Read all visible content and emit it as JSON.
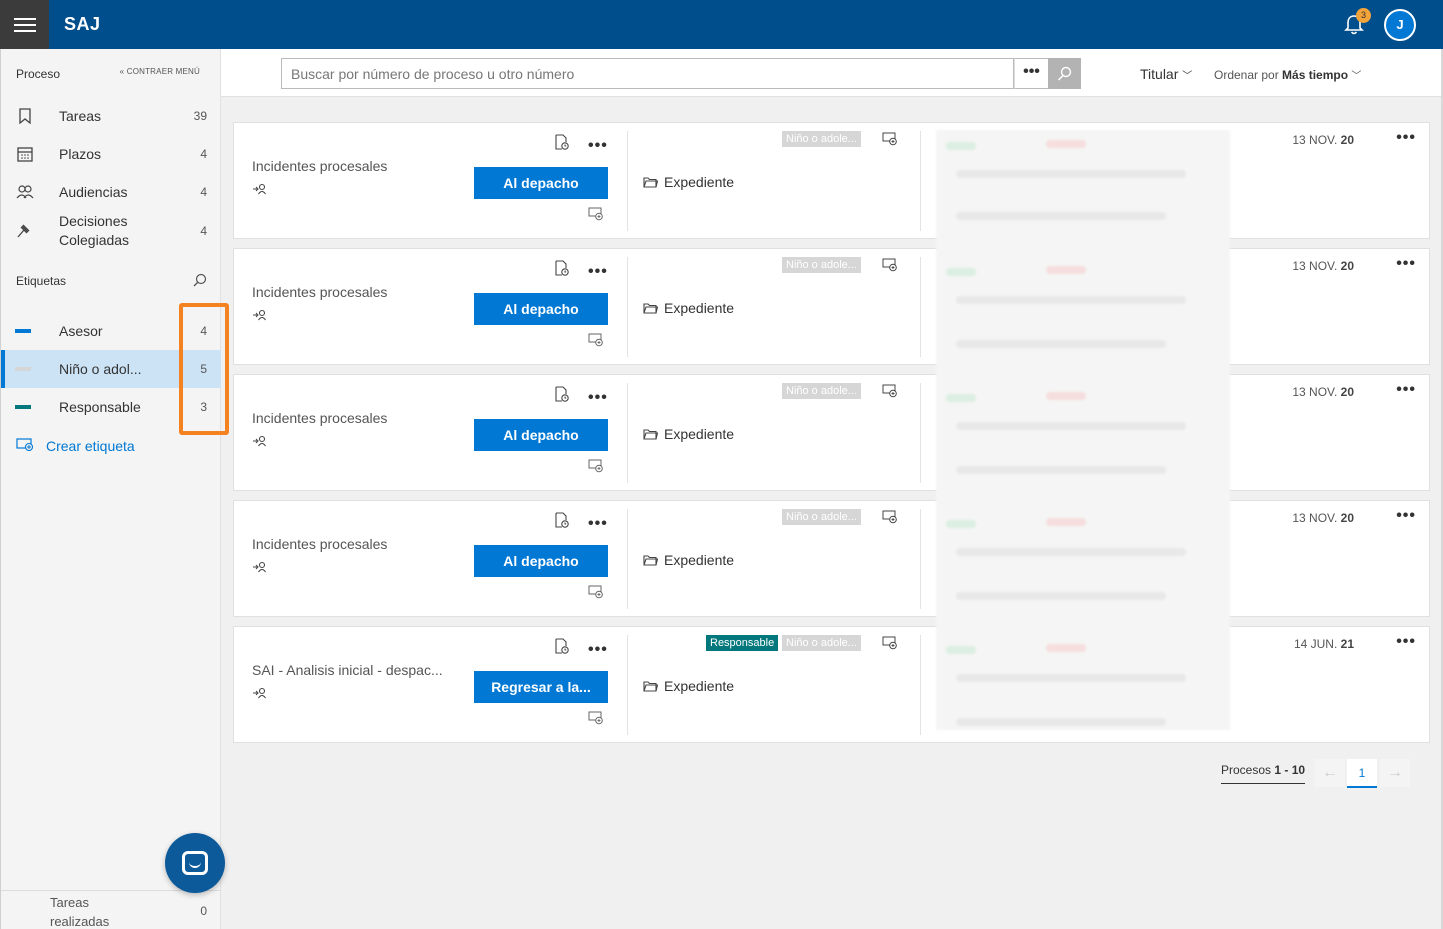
{
  "header": {
    "app_title": "SAJ",
    "notification_count": "3",
    "avatar_initial": "J"
  },
  "sidebar": {
    "section_title": "Proceso",
    "collapse_label": "CONTRAER MENÚ",
    "items": [
      {
        "label": "Tareas",
        "count": "39",
        "icon": "bookmark-icon"
      },
      {
        "label": "Plazos",
        "count": "4",
        "icon": "calendar-icon"
      },
      {
        "label": "Audiencias",
        "count": "4",
        "icon": "people-icon"
      },
      {
        "label": "Decisiones Colegiadas",
        "count": "4",
        "icon": "gavel-icon"
      }
    ],
    "tags_title": "Etiquetas",
    "tags": [
      {
        "label": "Asesor",
        "count": "4",
        "color": "#0078d4"
      },
      {
        "label": "Niño o adol...",
        "count": "5",
        "color": "#d6d6d6"
      },
      {
        "label": "Responsable",
        "count": "3",
        "color": "#03787c"
      }
    ],
    "create_tag_label": "Crear etiqueta",
    "done_label": "Tareas realizadas",
    "done_count": "0"
  },
  "search": {
    "placeholder": "Buscar por número de proceso u otro número",
    "more_label": "•••",
    "filter_label": "Titular",
    "order_prefix": "Ordenar por",
    "order_value": "Más tiempo"
  },
  "cards": [
    {
      "title": "Incidentes procesales",
      "action": "Al depacho",
      "folder": "Expediente",
      "tags": [
        "Niño o adole..."
      ],
      "date": "13 NOV.",
      "year": "20"
    },
    {
      "title": "Incidentes procesales",
      "action": "Al depacho",
      "folder": "Expediente",
      "tags": [
        "Niño o adole..."
      ],
      "date": "13 NOV.",
      "year": "20"
    },
    {
      "title": "Incidentes procesales",
      "action": "Al depacho",
      "folder": "Expediente",
      "tags": [
        "Niño o adole..."
      ],
      "date": "13 NOV.",
      "year": "20"
    },
    {
      "title": "Incidentes procesales",
      "action": "Al depacho",
      "folder": "Expediente",
      "tags": [
        "Niño o adole..."
      ],
      "date": "13 NOV.",
      "year": "20"
    },
    {
      "title": "SAI - Analisis inicial - despac...",
      "action": "Regresar a la...",
      "folder": "Expediente",
      "tags": [
        "Responsable",
        "Niño o adole..."
      ],
      "date": "14 JUN.",
      "year": "21"
    }
  ],
  "pagination": {
    "label_prefix": "Procesos",
    "range": "1 - 10",
    "current_page": "1",
    "prev": "←",
    "next": "→"
  },
  "colors": {
    "brand": "#004e8c",
    "accent": "#0078d4",
    "highlight": "#f58220",
    "teal_tag": "#03787c"
  }
}
